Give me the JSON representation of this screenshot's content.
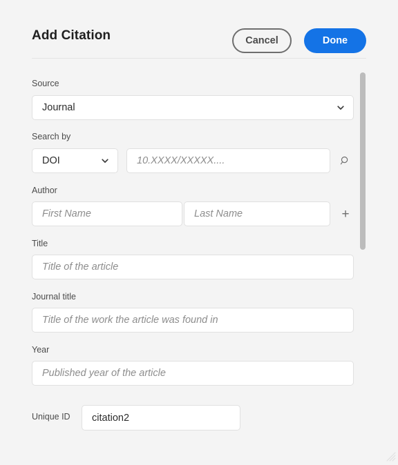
{
  "dialog": {
    "title": "Add Citation",
    "accent_color": "#1473e6",
    "background_color": "#f4f4f4",
    "field_background": "#ffffff"
  },
  "header": {
    "cancel_label": "Cancel",
    "done_label": "Done"
  },
  "form": {
    "source": {
      "label": "Source",
      "value": "Journal",
      "icon": "chevron-down-icon"
    },
    "search_by": {
      "label": "Search by",
      "type_value": "DOI",
      "type_icon": "chevron-down-icon",
      "query_value": "",
      "query_placeholder": "10.XXXX/XXXXX....",
      "search_icon": "search-icon"
    },
    "author": {
      "label": "Author",
      "first_name_value": "",
      "first_name_placeholder": "First Name",
      "last_name_value": "",
      "last_name_placeholder": "Last Name",
      "add_label": "+"
    },
    "title": {
      "label": "Title",
      "value": "",
      "placeholder": "Title of the article"
    },
    "journal_title": {
      "label": "Journal title",
      "value": "",
      "placeholder": "Title of the work the article was found in"
    },
    "year": {
      "label": "Year",
      "value": "",
      "placeholder": "Published year of the article"
    }
  },
  "footer": {
    "unique_id_label": "Unique ID",
    "unique_id_value": "citation2"
  },
  "scrollbar": {
    "orientation": "vertical",
    "thumb_color": "#bcbcbc"
  }
}
